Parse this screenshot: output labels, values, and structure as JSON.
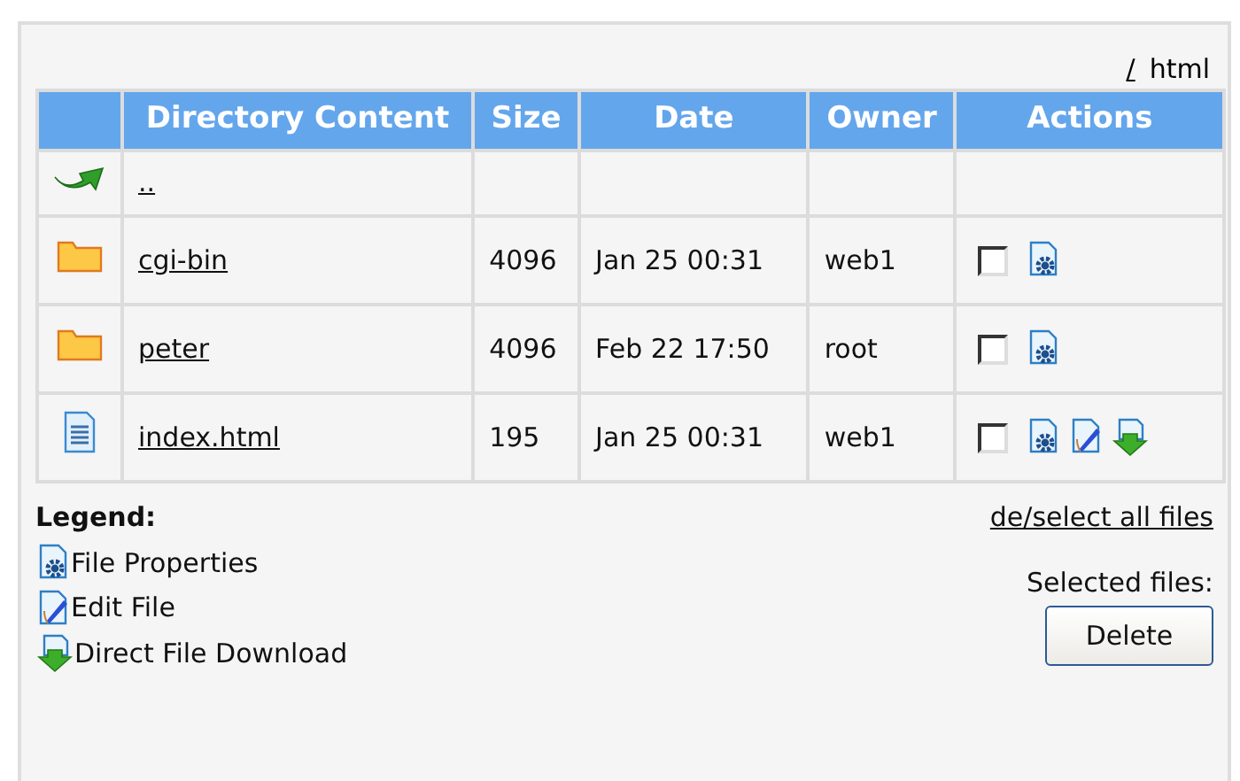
{
  "path": {
    "root_link": "/",
    "current": "html"
  },
  "table": {
    "columns": [
      "Directory Content",
      "Size",
      "Date",
      "Owner",
      "Actions"
    ],
    "rows": [
      {
        "kind": "parent",
        "name": ".."
      },
      {
        "kind": "folder",
        "name": "cgi-bin",
        "size": "4096",
        "date": "Jan 25 00:31",
        "owner": "web1",
        "checked": false,
        "actions": [
          {
            "kind": "properties"
          }
        ]
      },
      {
        "kind": "folder",
        "name": "peter",
        "size": "4096",
        "date": "Feb 22 17:50",
        "owner": "root",
        "checked": false,
        "actions": [
          {
            "kind": "properties"
          }
        ]
      },
      {
        "kind": "file",
        "name": "index.html",
        "size": "195",
        "date": "Jan 25 00:31",
        "owner": "web1",
        "checked": false,
        "actions": [
          {
            "kind": "properties"
          },
          {
            "kind": "edit"
          },
          {
            "kind": "download"
          }
        ]
      }
    ]
  },
  "legend": {
    "title": "Legend:",
    "items": [
      {
        "kind": "properties",
        "label": "File Properties"
      },
      {
        "kind": "edit",
        "label": "Edit File"
      },
      {
        "kind": "download",
        "label": "Direct File Download"
      }
    ]
  },
  "select_all_link": "de/select all files",
  "selected_files_label": "Selected files:",
  "delete_button": "Delete"
}
